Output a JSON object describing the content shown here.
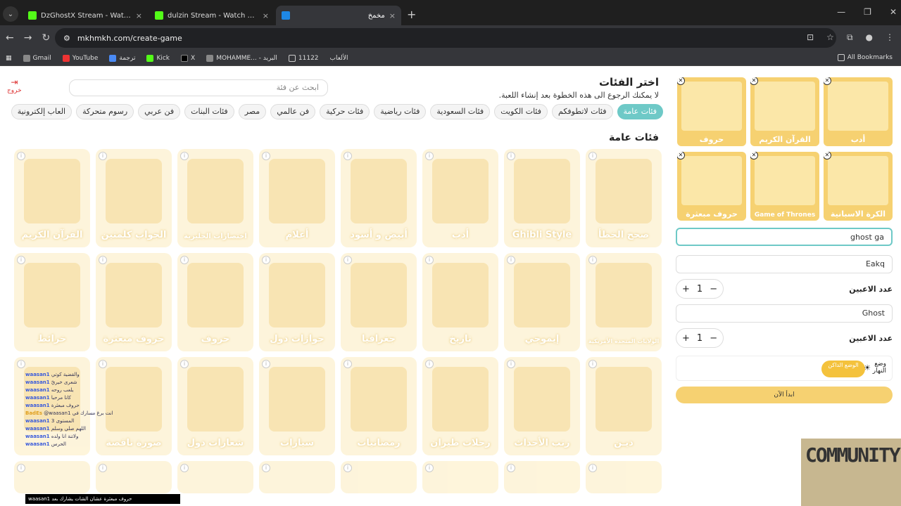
{
  "browser": {
    "tabs": [
      {
        "title": "DzGhostX Stream - Watch Live",
        "active": false,
        "close": "×"
      },
      {
        "title": "dulzin Stream - Watch Live on K",
        "active": false,
        "close": "×"
      },
      {
        "title": "مخمخ",
        "active": true,
        "close": "×"
      }
    ],
    "new_tab": "+",
    "url": "mkhmkh.com/create-game",
    "bookmarks": [
      "Gmail",
      "YouTube",
      "ترجمة",
      "Kick",
      "X",
      "MOHAMME... - البريد",
      "11122",
      "الألعاب"
    ],
    "all_bookmarks": "All Bookmarks"
  },
  "header": {
    "exit_label": "خروج",
    "search_placeholder": "ابحث عن فئة",
    "title": "اختر الفئات",
    "subtitle": "لا يمكنك الرجوع الى هذه الخطوة بعد إنشاء اللعبة."
  },
  "categories": [
    "فئات عامة",
    "فئات لاتطوفكم",
    "فئات الكويت",
    "فئات السعودية",
    "فئات رياضية",
    "فئات حركية",
    "فن عالمي",
    "مصر",
    "فئات البنات",
    "فن عربي",
    "رسوم متحركة",
    "العاب إلكترونية"
  ],
  "section_title": "فئات عامة",
  "cards": [
    "صحح الخطأ",
    "Ghibli Style",
    "أدب",
    "أبيض و أسود",
    "أعلام",
    "اختصارات الجليزية",
    "الجواب كلمتين",
    "القرآن الكريم",
    "الولايات المتحدة الأمريكية",
    "إيموجي",
    "تاريخ",
    "جغرافيا",
    "جوازات دول",
    "حروف",
    "حروف مبعثرة",
    "خرائط",
    "ديـن",
    "رتب الأحداث",
    "رحلات طيران",
    "رمضانيات",
    "سيارات",
    "شعارات دول",
    "صورة ناقصة",
    "",
    ""
  ],
  "selected": [
    {
      "label": "أدب"
    },
    {
      "label": "القرآن الكريم"
    },
    {
      "label": "حروف"
    },
    {
      "label": "الكرة الاسبانية"
    },
    {
      "label": "Game of Thrones"
    },
    {
      "label": "حروف مبعثرة"
    }
  ],
  "team1": {
    "name": "ghost ga",
    "players_label": "عدد الاعبين",
    "players": "1"
  },
  "team2_pre": {
    "name": "Eakq"
  },
  "team2": {
    "name": "Ghost",
    "players_label": "عدد الاعبين",
    "players": "1"
  },
  "mode": {
    "label": "وضع النهار",
    "toggle": "الوضع الداكن"
  },
  "start_button": "ابدأ الآن",
  "overlay": {
    "community": "COMMUNITY",
    "chat": [
      {
        "user": "waasan1",
        "msg": "والقضية كوتي"
      },
      {
        "user": "waasan1",
        "msg": "شعرى خيريّ"
      },
      {
        "user": "waasan1",
        "msg": "يلعب روحه"
      },
      {
        "user": "waasan1",
        "msg": "كانا مرحبا"
      },
      {
        "user": "waasan1",
        "msg": "حروف مبعثرة"
      },
      {
        "user": "BadEs",
        "msg": "@waasan1 انت برغ مسارك في"
      },
      {
        "user": "waasan1",
        "msg": "المستوى 3"
      },
      {
        "user": "waasan1",
        "msg": "اللهم صلي وسلم"
      },
      {
        "user": "waasan1",
        "msg": "ولاتنة انا ولده"
      },
      {
        "user": "waasan1",
        "msg": "الحرس"
      }
    ],
    "ticker": "waasan1 حروف مبعثرة عشان الشات يشارك بعد"
  }
}
